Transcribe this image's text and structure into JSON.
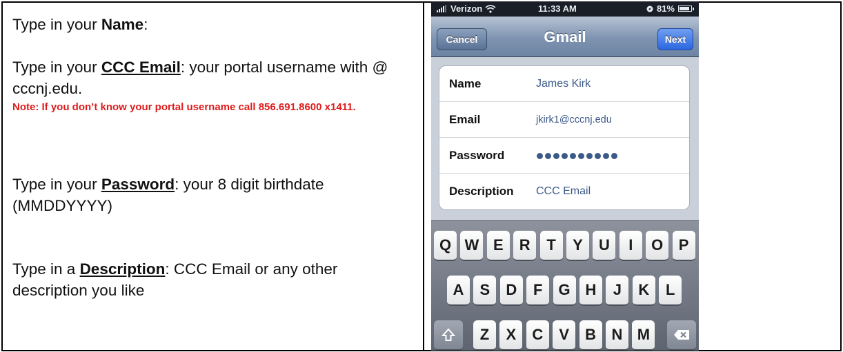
{
  "instructions": {
    "name": {
      "prefix": "Type in your ",
      "bold": "Name",
      "suffix": ":"
    },
    "email": {
      "prefix": "Type in your ",
      "bold": "CCC Email",
      "suffix": ": your portal username with @ cccnj.edu."
    },
    "note": "Note: If you don’t know your portal username call 856.691.8600 x1411.",
    "password": {
      "prefix": "Type in your ",
      "bold": "Password",
      "suffix": ": your 8 digit birthdate (MMDDYYYY)"
    },
    "description": {
      "prefix": "Type in a ",
      "bold": "Description",
      "suffix": ": CCC Email or any other description you like"
    }
  },
  "phone": {
    "status_bar": {
      "carrier": "Verizon",
      "time": "11:33 AM",
      "battery": "81%"
    },
    "nav": {
      "title": "Gmail",
      "cancel_label": "Cancel",
      "next_label": "Next"
    },
    "form": [
      {
        "label": "Name",
        "value": "James Kirk"
      },
      {
        "label": "Email",
        "value": "jkirk1@cccnj.edu"
      },
      {
        "label": "Password",
        "value": "••••••••••"
      },
      {
        "label": "Description",
        "value": "CCC Email"
      }
    ],
    "keyboard": {
      "row1": [
        "Q",
        "W",
        "E",
        "R",
        "T",
        "Y",
        "U",
        "I",
        "O",
        "P"
      ],
      "row2": [
        "A",
        "S",
        "D",
        "F",
        "G",
        "H",
        "J",
        "K",
        "L"
      ],
      "row3": [
        "Z",
        "X",
        "C",
        "V",
        "B",
        "N",
        "M"
      ]
    },
    "icons": {
      "wifi": "wifi-icon",
      "location": "location-arrow-icon",
      "battery": "battery-icon",
      "shift": "shift-icon",
      "backspace": "backspace-icon"
    }
  }
}
